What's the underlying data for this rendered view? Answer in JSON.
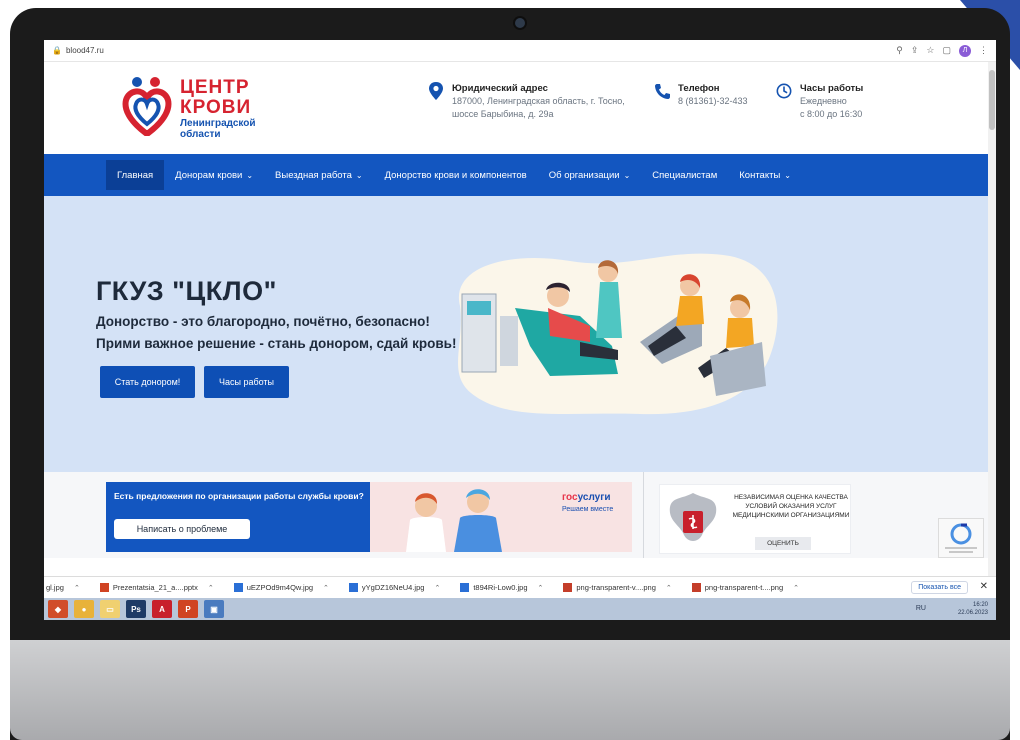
{
  "browser": {
    "url": "blood47.ru"
  },
  "logo": {
    "line1": "ЦЕНТР",
    "line2": "КРОВИ",
    "sub1": "Ленинградской",
    "sub2": "области"
  },
  "header": {
    "address_title": "Юридический адрес",
    "address_line1": "187000, Ленинградская область, г. Тосно,",
    "address_line2": "шоссе Барыбина, д. 29а",
    "phone_title": "Телефон",
    "phone_value": "8 (81361)-32-433",
    "hours_title": "Часы работы",
    "hours_line1": "Ежедневно",
    "hours_line2": "с 8:00 до 16:30"
  },
  "nav": {
    "items": [
      {
        "label": "Главная",
        "active": true,
        "dropdown": false
      },
      {
        "label": "Донорам крови",
        "active": false,
        "dropdown": true
      },
      {
        "label": "Выездная работа",
        "active": false,
        "dropdown": true
      },
      {
        "label": "Донорство крови и компонентов",
        "active": false,
        "dropdown": false
      },
      {
        "label": "Об организации",
        "active": false,
        "dropdown": true
      },
      {
        "label": "Специалистам",
        "active": false,
        "dropdown": false
      },
      {
        "label": "Контакты",
        "active": false,
        "dropdown": true
      }
    ]
  },
  "hero": {
    "title": "ГКУЗ \"ЦКЛО\"",
    "line1": "Донорство - это благородно, почётно, безопасно!",
    "line2": "Прими важное решение - стань донором, сдай кровь!",
    "btn_donor": "Стать донором!",
    "btn_hours": "Часы работы"
  },
  "banners": {
    "proposal_text": "Есть предложения по организации работы службы крови?",
    "proposal_btn": "Написать о проблеме",
    "gos_a": "гос",
    "gos_b": "услуги",
    "gos_sub": "Решаем вместе",
    "quality_text": "НЕЗАВИСИМАЯ ОЦЕНКА КАЧЕСТВА УСЛОВИЙ ОКАЗАНИЯ УСЛУГ МЕДИЦИНСКИМИ ОРГАНИЗАЦИЯМИ",
    "quality_btn": "ОЦЕНИТЬ"
  },
  "downloads": {
    "items": [
      {
        "name": "gl.jpg",
        "kind": "jpg"
      },
      {
        "name": "Prezentatsia_21_a....pptx",
        "kind": "pptx"
      },
      {
        "name": "uEZPOd9m4Qw.jpg",
        "kind": "jpg"
      },
      {
        "name": "yYgDZ16NeU4.jpg",
        "kind": "jpg"
      },
      {
        "name": "t894Ri-Low0.jpg",
        "kind": "jpg"
      },
      {
        "name": "png-transparent-v....png",
        "kind": "png"
      },
      {
        "name": "png-transparent-t....png",
        "kind": "png"
      }
    ],
    "show_all": "Показать все",
    "close": "✕"
  },
  "taskbar": {
    "lang": "RU",
    "time": "16:20",
    "date": "22.06.2023"
  },
  "colors": {
    "brand_blue": "#1356c0",
    "brand_red": "#d62330",
    "hero_bg": "#d4e2f6"
  }
}
